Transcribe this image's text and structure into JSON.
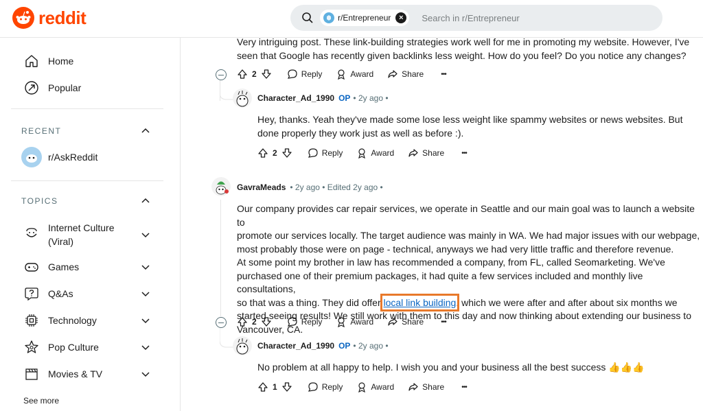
{
  "header": {
    "logo_text": "reddit",
    "chip_label": "r/Entrepreneur",
    "search_placeholder": "Search in r/Entrepreneur"
  },
  "sidebar": {
    "home": "Home",
    "popular": "Popular",
    "recent_title": "RECENT",
    "recent_item": "r/AskReddit",
    "topics_title": "TOPICS",
    "topics": [
      {
        "label": "Internet Culture",
        "label2": "(Viral)"
      },
      {
        "label": "Games"
      },
      {
        "label": "Q&As"
      },
      {
        "label": "Technology"
      },
      {
        "label": "Pop Culture"
      },
      {
        "label": "Movies & TV"
      }
    ],
    "see_more": "See more"
  },
  "comments": {
    "c1": {
      "line1": "Very intriguing post. These link-building strategies work well for me in promoting my website. However, I've",
      "line2": "seen that Google has recently given backlinks less weight. How do you feel? Do you notice any changes?",
      "votes": "2"
    },
    "r1": {
      "user": "Character_Ad_1990",
      "op": "OP",
      "meta": "• 2y ago •",
      "line1": "Hey, thanks. Yeah they've made some lose less weight like spammy websites or news websites. But",
      "line2": "done properly they work just as well as before :).",
      "votes": "2"
    },
    "c2": {
      "user": "GavraMeads",
      "meta": "• 2y ago • Edited 2y ago •",
      "line1": "Our company provides car repair services, we operate in Seattle and our main goal was to launch a website to",
      "line2": "promote our services locally. The target audience was mainly in WA. We had major issues with our webpage,",
      "line3": "most probably those were on page - technical, anyways we had very little traffic and therefore revenue.",
      "line4": "At some point my brother in law has recommended a company, from FL, called Seomarketing. We've",
      "line5": "purchased one of their premium packages, it had quite a few services included and monthly live consultations,",
      "line6_pre": "so that was a thing. They did offer ",
      "line6_link": "local link building",
      "line6_post": ", which we were after and after about six months we",
      "line7": "started seeing results! We still work with them to this day and now thinking about extending our business to",
      "line8": "Vancouver, CA.",
      "votes": "2"
    },
    "r2": {
      "user": "Character_Ad_1990",
      "op": "OP",
      "meta": "• 2y ago •",
      "line1": "No problem at all happy to help. I wish you and your business all the best success 👍👍👍",
      "votes": "1"
    }
  },
  "actions": {
    "reply": "Reply",
    "award": "Award",
    "share": "Share",
    "more": "•••"
  },
  "colors": {
    "brand": "#ff4500",
    "op": "#0a65c2",
    "highlight": "#e8792b"
  }
}
